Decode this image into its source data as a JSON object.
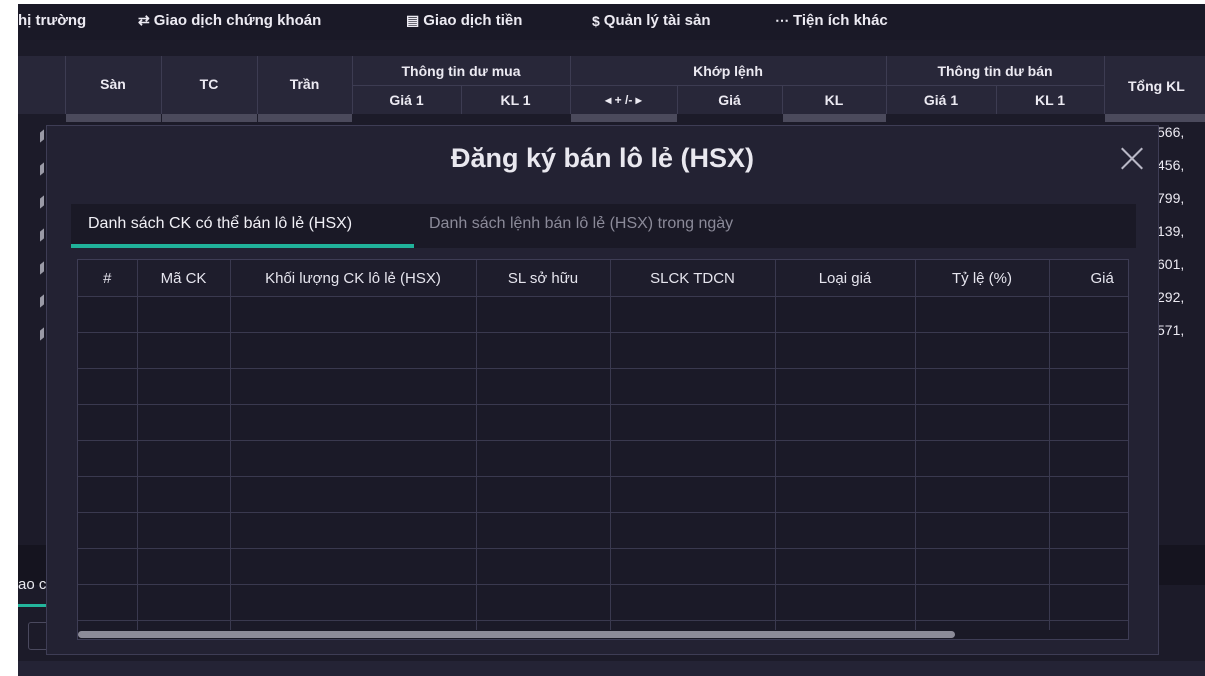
{
  "nav": {
    "items": [
      {
        "label": "hị trường",
        "icon": ""
      },
      {
        "label": "Giao dịch chứng khoán",
        "icon": "⇄"
      },
      {
        "label": "Giao dịch tiền",
        "icon": "▤"
      },
      {
        "label": "Quản lý tài sản",
        "icon": "$"
      },
      {
        "label": "Tiện ích khác",
        "icon": "⋯"
      }
    ]
  },
  "board": {
    "headers": {
      "san": "Sàn",
      "tc": "TC",
      "tran": "Trần",
      "buy_group": "Thông tin dư mua",
      "buy_price": "Giá 1",
      "buy_vol": "KL 1",
      "match_group": "Khớp lệnh",
      "match_change": "◂ + /- ▸",
      "match_price": "Giá",
      "match_vol": "KL",
      "sell_group": "Thông tin dư bán",
      "sell_price": "Giá 1",
      "sell_vol": "KL 1",
      "total": "Tổng KL"
    },
    "right_values": [
      "566,",
      "456,",
      "799,",
      "139,",
      "601,",
      "292,",
      "571,"
    ],
    "lower_tab_fragment": "ao c"
  },
  "modal": {
    "title": "Đăng ký bán lô lẻ (HSX)",
    "tabs": [
      {
        "label": "Danh sách CK có thể bán lô lẻ (HSX)",
        "active": true
      },
      {
        "label": "Danh sách lệnh bán lô lẻ (HSX) trong ngày",
        "active": false
      }
    ],
    "table": {
      "columns": [
        "#",
        "Mã CK",
        "Khối lượng CK lô lẻ (HSX)",
        "SL sở hữu",
        "SLCK TDCN",
        "Loại giá",
        "Tỷ lệ (%)",
        "Giá"
      ],
      "empty_row_count": 10
    }
  },
  "colors": {
    "background": "#1c1b29",
    "modal": "#232233",
    "accent": "#20b29a"
  }
}
